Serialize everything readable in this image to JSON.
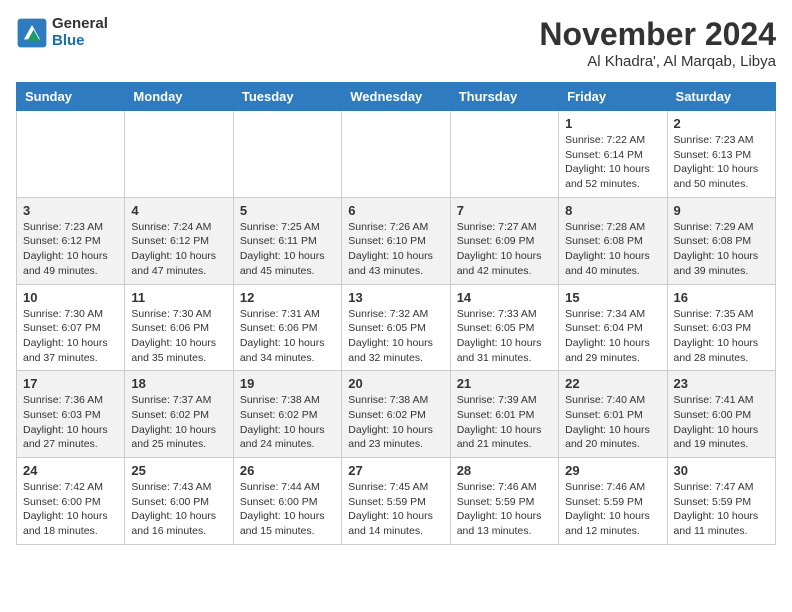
{
  "header": {
    "logo": {
      "line1": "General",
      "line2": "Blue"
    },
    "title": "November 2024",
    "location": "Al Khadra', Al Marqab, Libya"
  },
  "columns": [
    "Sunday",
    "Monday",
    "Tuesday",
    "Wednesday",
    "Thursday",
    "Friday",
    "Saturday"
  ],
  "weeks": [
    [
      {
        "day": "",
        "info": ""
      },
      {
        "day": "",
        "info": ""
      },
      {
        "day": "",
        "info": ""
      },
      {
        "day": "",
        "info": ""
      },
      {
        "day": "",
        "info": ""
      },
      {
        "day": "1",
        "info": "Sunrise: 7:22 AM\nSunset: 6:14 PM\nDaylight: 10 hours\nand 52 minutes."
      },
      {
        "day": "2",
        "info": "Sunrise: 7:23 AM\nSunset: 6:13 PM\nDaylight: 10 hours\nand 50 minutes."
      }
    ],
    [
      {
        "day": "3",
        "info": "Sunrise: 7:23 AM\nSunset: 6:12 PM\nDaylight: 10 hours\nand 49 minutes."
      },
      {
        "day": "4",
        "info": "Sunrise: 7:24 AM\nSunset: 6:12 PM\nDaylight: 10 hours\nand 47 minutes."
      },
      {
        "day": "5",
        "info": "Sunrise: 7:25 AM\nSunset: 6:11 PM\nDaylight: 10 hours\nand 45 minutes."
      },
      {
        "day": "6",
        "info": "Sunrise: 7:26 AM\nSunset: 6:10 PM\nDaylight: 10 hours\nand 43 minutes."
      },
      {
        "day": "7",
        "info": "Sunrise: 7:27 AM\nSunset: 6:09 PM\nDaylight: 10 hours\nand 42 minutes."
      },
      {
        "day": "8",
        "info": "Sunrise: 7:28 AM\nSunset: 6:08 PM\nDaylight: 10 hours\nand 40 minutes."
      },
      {
        "day": "9",
        "info": "Sunrise: 7:29 AM\nSunset: 6:08 PM\nDaylight: 10 hours\nand 39 minutes."
      }
    ],
    [
      {
        "day": "10",
        "info": "Sunrise: 7:30 AM\nSunset: 6:07 PM\nDaylight: 10 hours\nand 37 minutes."
      },
      {
        "day": "11",
        "info": "Sunrise: 7:30 AM\nSunset: 6:06 PM\nDaylight: 10 hours\nand 35 minutes."
      },
      {
        "day": "12",
        "info": "Sunrise: 7:31 AM\nSunset: 6:06 PM\nDaylight: 10 hours\nand 34 minutes."
      },
      {
        "day": "13",
        "info": "Sunrise: 7:32 AM\nSunset: 6:05 PM\nDaylight: 10 hours\nand 32 minutes."
      },
      {
        "day": "14",
        "info": "Sunrise: 7:33 AM\nSunset: 6:05 PM\nDaylight: 10 hours\nand 31 minutes."
      },
      {
        "day": "15",
        "info": "Sunrise: 7:34 AM\nSunset: 6:04 PM\nDaylight: 10 hours\nand 29 minutes."
      },
      {
        "day": "16",
        "info": "Sunrise: 7:35 AM\nSunset: 6:03 PM\nDaylight: 10 hours\nand 28 minutes."
      }
    ],
    [
      {
        "day": "17",
        "info": "Sunrise: 7:36 AM\nSunset: 6:03 PM\nDaylight: 10 hours\nand 27 minutes."
      },
      {
        "day": "18",
        "info": "Sunrise: 7:37 AM\nSunset: 6:02 PM\nDaylight: 10 hours\nand 25 minutes."
      },
      {
        "day": "19",
        "info": "Sunrise: 7:38 AM\nSunset: 6:02 PM\nDaylight: 10 hours\nand 24 minutes."
      },
      {
        "day": "20",
        "info": "Sunrise: 7:38 AM\nSunset: 6:02 PM\nDaylight: 10 hours\nand 23 minutes."
      },
      {
        "day": "21",
        "info": "Sunrise: 7:39 AM\nSunset: 6:01 PM\nDaylight: 10 hours\nand 21 minutes."
      },
      {
        "day": "22",
        "info": "Sunrise: 7:40 AM\nSunset: 6:01 PM\nDaylight: 10 hours\nand 20 minutes."
      },
      {
        "day": "23",
        "info": "Sunrise: 7:41 AM\nSunset: 6:00 PM\nDaylight: 10 hours\nand 19 minutes."
      }
    ],
    [
      {
        "day": "24",
        "info": "Sunrise: 7:42 AM\nSunset: 6:00 PM\nDaylight: 10 hours\nand 18 minutes."
      },
      {
        "day": "25",
        "info": "Sunrise: 7:43 AM\nSunset: 6:00 PM\nDaylight: 10 hours\nand 16 minutes."
      },
      {
        "day": "26",
        "info": "Sunrise: 7:44 AM\nSunset: 6:00 PM\nDaylight: 10 hours\nand 15 minutes."
      },
      {
        "day": "27",
        "info": "Sunrise: 7:45 AM\nSunset: 5:59 PM\nDaylight: 10 hours\nand 14 minutes."
      },
      {
        "day": "28",
        "info": "Sunrise: 7:46 AM\nSunset: 5:59 PM\nDaylight: 10 hours\nand 13 minutes."
      },
      {
        "day": "29",
        "info": "Sunrise: 7:46 AM\nSunset: 5:59 PM\nDaylight: 10 hours\nand 12 minutes."
      },
      {
        "day": "30",
        "info": "Sunrise: 7:47 AM\nSunset: 5:59 PM\nDaylight: 10 hours\nand 11 minutes."
      }
    ]
  ]
}
